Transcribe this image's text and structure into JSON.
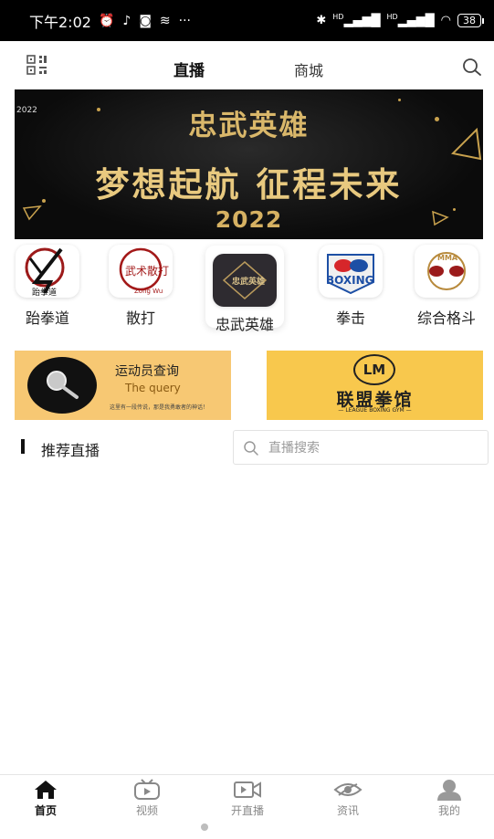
{
  "status_bar": {
    "time": "下午2:02",
    "dots": "···",
    "battery": "38",
    "hd1": "HD",
    "hd2": "HD"
  },
  "top_nav": {
    "tabs": [
      {
        "label": "直播",
        "active": true
      },
      {
        "label": "商城",
        "active": false
      }
    ]
  },
  "banner": {
    "small_text": "2022",
    "title": "忠武英雄",
    "slogan": "梦想起航  征程未来",
    "year": "2022"
  },
  "categories": [
    {
      "label": "跆拳道",
      "logo_text": "跆拳道"
    },
    {
      "label": "散打",
      "logo_text": "武术散打"
    },
    {
      "label": "忠武英雄",
      "logo_text": "忠武英雄",
      "selected": true
    },
    {
      "label": "拳击",
      "logo_text": "BOXING"
    },
    {
      "label": "综合格斗",
      "logo_text": "MMA"
    }
  ],
  "promo": {
    "query": {
      "title": "运动员查询",
      "subtitle": "The query",
      "note": "这里有一段传说，那是我勇敢者的神话！"
    },
    "gym": {
      "logo": "LM",
      "name": "联盟拳馆",
      "english": "— LEAGUE BOXING GYM —"
    }
  },
  "recommend": {
    "title": "推荐直播",
    "search_placeholder": "直播搜索",
    "search_value": ""
  },
  "bottom_nav": [
    {
      "label": "首页",
      "icon": "home-icon",
      "active": true
    },
    {
      "label": "视频",
      "icon": "tv-icon",
      "active": false
    },
    {
      "label": "开直播",
      "icon": "video-camera-icon",
      "active": false
    },
    {
      "label": "资讯",
      "icon": "news-icon",
      "active": false
    },
    {
      "label": "我的",
      "icon": "user-icon",
      "active": false
    }
  ],
  "colors": {
    "status_bar_bg": "#000000",
    "banner_gold": "#d9b76a",
    "promo_query_bg": "#f7c873",
    "promo_gym_bg": "#f8c84d",
    "active_text": "#111111",
    "inactive_text": "#8a8a8a"
  }
}
